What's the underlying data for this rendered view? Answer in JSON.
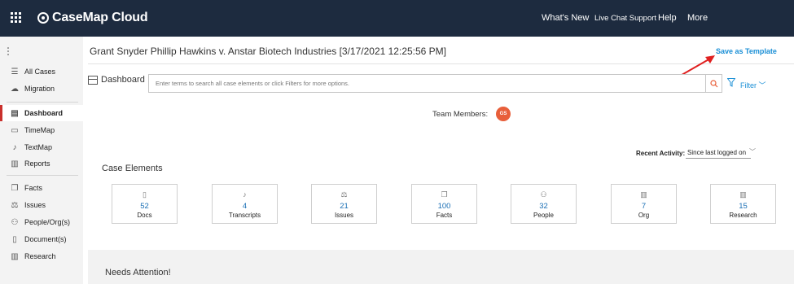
{
  "header": {
    "logo": "CaseMap Cloud",
    "nav": [
      "What's New",
      "Live Chat Support",
      "Help",
      "More"
    ]
  },
  "sidebar": {
    "items": [
      {
        "label": "All Cases",
        "icon": "list-icon"
      },
      {
        "label": "Migration",
        "icon": "cloud-upload-icon"
      },
      {
        "label": "Dashboard",
        "icon": "dashboard-icon",
        "active": true
      },
      {
        "label": "TimeMap",
        "icon": "timemap-icon"
      },
      {
        "label": "TextMap",
        "icon": "microphone-icon"
      },
      {
        "label": "Reports",
        "icon": "report-icon"
      },
      {
        "label": "Facts",
        "icon": "facts-icon"
      },
      {
        "label": "Issues",
        "icon": "issues-icon"
      },
      {
        "label": "People/Org(s)",
        "icon": "people-icon"
      },
      {
        "label": "Document(s)",
        "icon": "document-icon"
      },
      {
        "label": "Research",
        "icon": "research-icon"
      }
    ]
  },
  "main": {
    "case_title": "Grant Snyder Phillip Hawkins v. Anstar Biotech Industries [3/17/2021 12:25:56 PM]",
    "save_as_template": "Save as Template",
    "dashboard_label": "Dashboard",
    "search_placeholder": "Enter terms to search all case elements or click Filters for more options.",
    "filter_label": "Filter",
    "team_members_label": "Team Members:",
    "team_members": [
      {
        "initials": "GS",
        "color": "#e85f3a"
      }
    ],
    "recent_activity_label": "Recent Activity:",
    "recent_activity_value": "Since last logged on",
    "case_elements_title": "Case Elements",
    "case_elements": [
      {
        "count": "52",
        "label": "Docs",
        "icon": "document-icon"
      },
      {
        "count": "4",
        "label": "Transcripts",
        "icon": "microphone-icon"
      },
      {
        "count": "21",
        "label": "Issues",
        "icon": "issues-icon"
      },
      {
        "count": "100",
        "label": "Facts",
        "icon": "facts-icon"
      },
      {
        "count": "32",
        "label": "People",
        "icon": "people-icon"
      },
      {
        "count": "7",
        "label": "Org",
        "icon": "org-icon"
      },
      {
        "count": "15",
        "label": "Research",
        "icon": "research-icon"
      }
    ],
    "needs_attention_title": "Needs Attention!"
  },
  "colors": {
    "topbar": "#1d2b3f",
    "accent": "#1a8fd6",
    "active_marker": "#c9302c",
    "annotation_arrow": "#e02020"
  }
}
